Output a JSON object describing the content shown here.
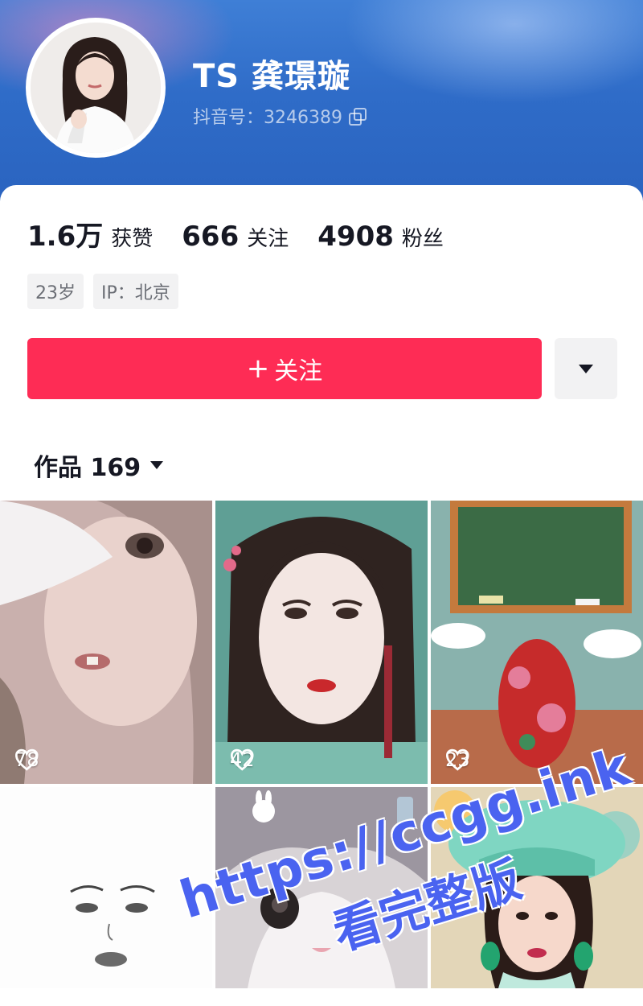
{
  "profile": {
    "name": "TS 龚璟璇",
    "douyin_id": "抖音号：3246389",
    "avatar_icon": "profile-photo"
  },
  "stats": [
    {
      "value": "1.6万",
      "label": "获赞"
    },
    {
      "value": "666",
      "label": "关注"
    },
    {
      "value": "4908",
      "label": "粉丝"
    }
  ],
  "tags": [
    "23岁",
    "IP：北京"
  ],
  "actions": {
    "follow_label": "关注",
    "follow_plus": "+",
    "accent_color": "#fe2c55"
  },
  "works_tab": {
    "label": "作品 169"
  },
  "posts": [
    {
      "likes": "78",
      "theme": "illustrated-girl-feather"
    },
    {
      "likes": "42",
      "theme": "illustrated-traditional-girl"
    },
    {
      "likes": "23",
      "theme": "quiz-chalkboard"
    },
    {
      "likes": "",
      "theme": "face-sketch"
    },
    {
      "likes": "",
      "theme": "cat-closeup"
    },
    {
      "likes": "",
      "theme": "woman-green-hat"
    }
  ],
  "watermark": {
    "url": "https://ccgg.ink",
    "text": "看完整版"
  }
}
